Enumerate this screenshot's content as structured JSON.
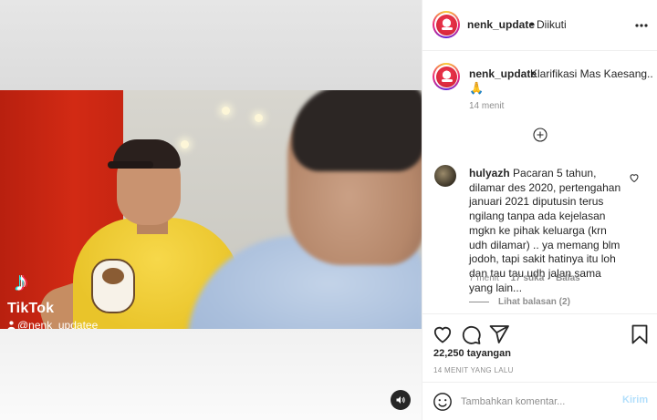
{
  "post": {
    "username": "nenk_update",
    "separator": "•",
    "follow_status": "Diikuti",
    "caption": "Klarifikasi Mas Kaesang...",
    "caption_emoji": "🙏",
    "caption_time": "14 menit",
    "views": "22,250 tayangan",
    "time_ago": "14 MENIT YANG LALU"
  },
  "video_overlay": {
    "tiktok_logo": "♪",
    "tiktok_label": "TikTok",
    "tiktok_user": "@nenk_updatee"
  },
  "comment": {
    "username": "hulyazh",
    "text": "Pacaran 5 tahun, dilamar des 2020, pertengahan januari 2021 diputusin terus ngilang tanpa ada kejelasan mgkn ke pihak keluarga (krn udh dilamar) .. ya memang blm jodoh, tapi sakit hatinya itu loh dan tau tau udh jalan sama yang lain...",
    "time": "7 menit",
    "likes": "17 suka",
    "reply": "Balas",
    "view_replies": "Lihat balasan (2)"
  },
  "comment_box": {
    "placeholder": "Tambahkan komentar...",
    "post_label": "Kirim"
  },
  "icons": {
    "more": "more-icon",
    "load_more": "plus-circle-icon",
    "like": "heart-icon",
    "comment": "comment-icon",
    "share": "send-icon",
    "save": "bookmark-icon",
    "emoji": "smile-icon",
    "audio": "speaker-icon"
  },
  "colors": {
    "link_disabled": "#b2dffc",
    "meta": "#8e8e8e",
    "text": "#262626"
  }
}
